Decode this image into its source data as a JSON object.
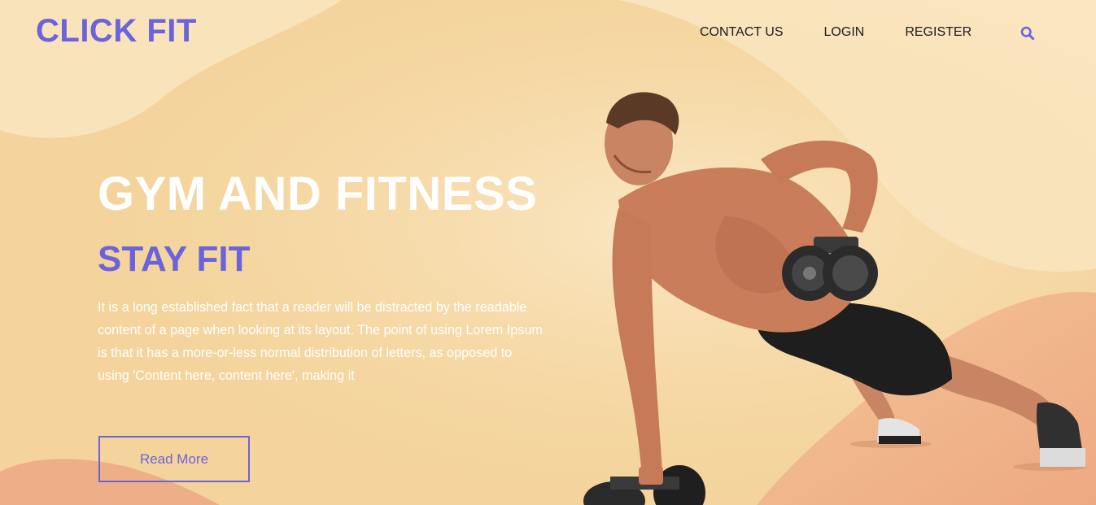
{
  "header": {
    "logo": "CLICK FIT",
    "nav": [
      {
        "label": "CONTACT US"
      },
      {
        "label": "LOGIN"
      },
      {
        "label": "REGISTER"
      }
    ],
    "search_icon": "search-icon"
  },
  "hero": {
    "title": "GYM AND FITNESS",
    "subtitle": "STAY FIT",
    "text": "It is a long established fact that a reader will be distracted by the readable content of a page when looking at its layout. The point of using Lorem Ipsum is that it has a more-or-less normal distribution of letters, as opposed to using 'Content here, content here', making it",
    "button_label": "Read More",
    "image": "man-doing-dumbbell-pushup-photo"
  },
  "colors": {
    "accent": "#6c63dc",
    "background": "#f5d8a4",
    "wave_light": "#fae7c2",
    "wave_peach": "#f0b48a",
    "heading": "#ffffff"
  }
}
